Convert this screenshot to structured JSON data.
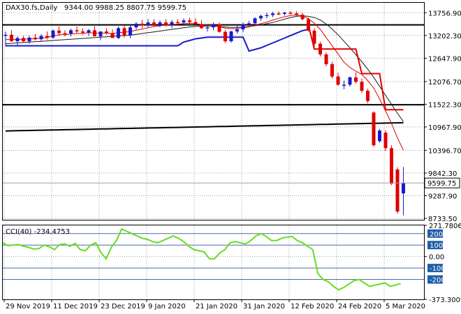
{
  "header": {
    "symbol": "DAX30.fs,Daily",
    "ohlc": "9344.00 9988.25 8807.75 9599.75"
  },
  "colors": {
    "bull": "#1a1acc",
    "bear": "#e00000",
    "ma_fast": "#e00000",
    "ma_slow": "#1a1a1a",
    "envelope_upper": "#e00000",
    "envelope_lower": "#1a1acc",
    "cci": "#66dd22",
    "level_line": "#000000",
    "level_box": "#1f5fa8"
  },
  "chart_data": [
    {
      "type": "candlestick",
      "title": "DAX30.fs,Daily",
      "ylim": [
        8700,
        14000
      ],
      "y_ticks": [
        13756.9,
        13202.3,
        12647.9,
        12076.7,
        11522.3,
        10967.9,
        10396.7,
        9842.3,
        9287.9,
        8733.5
      ],
      "x_tick_labels": [
        {
          "label": "29 Nov 2019",
          "index": 0
        },
        {
          "label": "11 Dec 2019",
          "index": 8
        },
        {
          "label": "23 Dec 2019",
          "index": 16
        },
        {
          "label": "9 Jan 2020",
          "index": 24
        },
        {
          "label": "21 Jan 2020",
          "index": 32
        },
        {
          "label": "31 Jan 2020",
          "index": 40
        },
        {
          "label": "12 Feb 2020",
          "index": 48
        },
        {
          "label": "24 Feb 2020",
          "index": 56
        },
        {
          "label": "5 Mar 2020",
          "index": 64
        }
      ],
      "current_price": 9599.75,
      "horizontal_levels": [
        13460,
        11510
      ],
      "candles": [
        {
          "o": 13210,
          "h": 13300,
          "l": 12940,
          "c": 13220
        },
        {
          "o": 13220,
          "h": 13340,
          "l": 13050,
          "c": 13060
        },
        {
          "o": 13060,
          "h": 13180,
          "l": 12950,
          "c": 13140
        },
        {
          "o": 13140,
          "h": 13190,
          "l": 13020,
          "c": 13060
        },
        {
          "o": 13060,
          "h": 13200,
          "l": 13000,
          "c": 13150
        },
        {
          "o": 13150,
          "h": 13240,
          "l": 13080,
          "c": 13110
        },
        {
          "o": 13110,
          "h": 13230,
          "l": 13060,
          "c": 13190
        },
        {
          "o": 13190,
          "h": 13300,
          "l": 13100,
          "c": 13150
        },
        {
          "o": 13150,
          "h": 13350,
          "l": 13120,
          "c": 13320
        },
        {
          "o": 13320,
          "h": 13420,
          "l": 13200,
          "c": 13260
        },
        {
          "o": 13260,
          "h": 13330,
          "l": 13180,
          "c": 13250
        },
        {
          "o": 13250,
          "h": 13370,
          "l": 13180,
          "c": 13330
        },
        {
          "o": 13330,
          "h": 13420,
          "l": 13250,
          "c": 13300
        },
        {
          "o": 13300,
          "h": 13380,
          "l": 13220,
          "c": 13270
        },
        {
          "o": 13270,
          "h": 13360,
          "l": 13190,
          "c": 13330
        },
        {
          "o": 13330,
          "h": 13430,
          "l": 13250,
          "c": 13180
        },
        {
          "o": 13180,
          "h": 13300,
          "l": 13090,
          "c": 13300
        },
        {
          "o": 13300,
          "h": 13380,
          "l": 13220,
          "c": 13260
        },
        {
          "o": 13260,
          "h": 13350,
          "l": 13180,
          "c": 13140
        },
        {
          "o": 13140,
          "h": 13420,
          "l": 13120,
          "c": 13380
        },
        {
          "o": 13380,
          "h": 13460,
          "l": 13150,
          "c": 13200
        },
        {
          "o": 13200,
          "h": 13470,
          "l": 13140,
          "c": 13400
        },
        {
          "o": 13400,
          "h": 13530,
          "l": 13350,
          "c": 13490
        },
        {
          "o": 13490,
          "h": 13580,
          "l": 13380,
          "c": 13450
        },
        {
          "o": 13450,
          "h": 13600,
          "l": 13400,
          "c": 13520
        },
        {
          "o": 13520,
          "h": 13600,
          "l": 13410,
          "c": 13460
        },
        {
          "o": 13460,
          "h": 13570,
          "l": 13400,
          "c": 13520
        },
        {
          "o": 13520,
          "h": 13600,
          "l": 13420,
          "c": 13470
        },
        {
          "o": 13470,
          "h": 13580,
          "l": 13380,
          "c": 13530
        },
        {
          "o": 13530,
          "h": 13600,
          "l": 13440,
          "c": 13520
        },
        {
          "o": 13520,
          "h": 13620,
          "l": 13460,
          "c": 13570
        },
        {
          "o": 13570,
          "h": 13640,
          "l": 13480,
          "c": 13530
        },
        {
          "o": 13530,
          "h": 13620,
          "l": 13450,
          "c": 13480
        },
        {
          "o": 13480,
          "h": 13580,
          "l": 13360,
          "c": 13380
        },
        {
          "o": 13380,
          "h": 13460,
          "l": 13300,
          "c": 13400
        },
        {
          "o": 13400,
          "h": 13520,
          "l": 13330,
          "c": 13480
        },
        {
          "o": 13480,
          "h": 13520,
          "l": 13270,
          "c": 13290
        },
        {
          "o": 13290,
          "h": 13330,
          "l": 13020,
          "c": 13060
        },
        {
          "o": 13060,
          "h": 13320,
          "l": 13030,
          "c": 13300
        },
        {
          "o": 13300,
          "h": 13460,
          "l": 13250,
          "c": 13350
        },
        {
          "o": 13350,
          "h": 13520,
          "l": 13280,
          "c": 13480
        },
        {
          "o": 13480,
          "h": 13560,
          "l": 13420,
          "c": 13500
        },
        {
          "o": 13500,
          "h": 13650,
          "l": 13480,
          "c": 13620
        },
        {
          "o": 13620,
          "h": 13710,
          "l": 13560,
          "c": 13680
        },
        {
          "o": 13680,
          "h": 13760,
          "l": 13620,
          "c": 13700
        },
        {
          "o": 13700,
          "h": 13780,
          "l": 13650,
          "c": 13740
        },
        {
          "o": 13740,
          "h": 13790,
          "l": 13700,
          "c": 13730
        },
        {
          "o": 13730,
          "h": 13780,
          "l": 13690,
          "c": 13760
        },
        {
          "o": 13760,
          "h": 13800,
          "l": 13710,
          "c": 13740
        },
        {
          "o": 13740,
          "h": 13790,
          "l": 13680,
          "c": 13710
        },
        {
          "o": 13710,
          "h": 13760,
          "l": 13570,
          "c": 13600
        },
        {
          "o": 13600,
          "h": 13640,
          "l": 13300,
          "c": 13320
        },
        {
          "o": 13320,
          "h": 13380,
          "l": 12900,
          "c": 13000
        },
        {
          "o": 13000,
          "h": 13050,
          "l": 12690,
          "c": 12740
        },
        {
          "o": 12740,
          "h": 12790,
          "l": 12450,
          "c": 12500
        },
        {
          "o": 12500,
          "h": 12560,
          "l": 12150,
          "c": 12200
        },
        {
          "o": 12200,
          "h": 12290,
          "l": 11970,
          "c": 12000
        },
        {
          "o": 12000,
          "h": 12100,
          "l": 11890,
          "c": 12000
        },
        {
          "o": 12000,
          "h": 12200,
          "l": 11950,
          "c": 12180
        },
        {
          "o": 12180,
          "h": 12300,
          "l": 12030,
          "c": 12070
        },
        {
          "o": 12070,
          "h": 12150,
          "l": 11800,
          "c": 11850
        },
        {
          "o": 11850,
          "h": 11900,
          "l": 11550,
          "c": 11600
        },
        {
          "o": 11320,
          "h": 11350,
          "l": 10480,
          "c": 10520
        },
        {
          "o": 10620,
          "h": 10920,
          "l": 10580,
          "c": 10880
        },
        {
          "o": 10830,
          "h": 10890,
          "l": 10380,
          "c": 10450
        },
        {
          "o": 10450,
          "h": 10520,
          "l": 9550,
          "c": 9580
        },
        {
          "o": 9930,
          "h": 9980,
          "l": 8850,
          "c": 8900
        },
        {
          "o": 9344.0,
          "h": 9988.25,
          "l": 8807.75,
          "c": 9599.75
        }
      ],
      "ma_fast": [
        13100,
        13110,
        13100,
        13110,
        13120,
        13120,
        13140,
        13150,
        13190,
        13220,
        13220,
        13240,
        13250,
        13250,
        13270,
        13260,
        13260,
        13260,
        13250,
        13270,
        13280,
        13300,
        13330,
        13360,
        13390,
        13420,
        13440,
        13460,
        13470,
        13480,
        13490,
        13500,
        13490,
        13470,
        13460,
        13450,
        13420,
        13380,
        13370,
        13370,
        13390,
        13410,
        13450,
        13490,
        13530,
        13580,
        13620,
        13660,
        13690,
        13700,
        13680,
        13610,
        13500,
        13350,
        13150,
        12950,
        12750,
        12550,
        12420,
        12330,
        12250,
        12100,
        11920,
        11650,
        11360,
        11050,
        10700,
        10400
      ],
      "ma_slow": [
        13000,
        13010,
        13020,
        13030,
        13040,
        13050,
        13060,
        13070,
        13080,
        13090,
        13100,
        13110,
        13120,
        13130,
        13140,
        13150,
        13160,
        13170,
        13180,
        13190,
        13200,
        13210,
        13230,
        13250,
        13270,
        13290,
        13310,
        13330,
        13350,
        13370,
        13390,
        13410,
        13420,
        13430,
        13430,
        13430,
        13420,
        13410,
        13400,
        13400,
        13410,
        13420,
        13440,
        13460,
        13490,
        13520,
        13560,
        13600,
        13640,
        13670,
        13680,
        13670,
        13640,
        13580,
        13480,
        13360,
        13220,
        13060,
        12900,
        12730,
        12560,
        12380,
        12180,
        11960,
        11740,
        11520,
        11300,
        11100
      ],
      "ma_long": [
        10870,
        10873,
        10876,
        10879,
        10882,
        10885,
        10888,
        10891,
        10894,
        10897,
        10900,
        10903,
        10906,
        10909,
        10912,
        10915,
        10918,
        10921,
        10924,
        10927,
        10930,
        10933,
        10936,
        10939,
        10942,
        10945,
        10948,
        10951,
        10954,
        10957,
        10960,
        10963,
        10966,
        10969,
        10972,
        10975,
        10978,
        10981,
        10984,
        10987,
        10990,
        10993,
        10996,
        10999,
        11002,
        11005,
        11008,
        11011,
        11014,
        11017,
        11020,
        11023,
        11026,
        11029,
        11032,
        11035,
        11038,
        11041,
        11044,
        11047,
        11050,
        11053,
        11056,
        11059,
        11062,
        11065,
        11068,
        11071
      ],
      "envelope_upper": {
        "x": [
          47,
          52,
          53,
          57,
          58,
          62,
          63,
          65,
          68
        ],
        "y": [
          13460,
          13460,
          13460,
          13460,
          13460,
          13460,
          13460,
          13460,
          13460
        ]
      },
      "step_upper": {
        "x": [
          51,
          52,
          59,
          60,
          63,
          64,
          67
        ],
        "y": [
          13460,
          12870,
          12870,
          12270,
          12270,
          11390,
          11390
        ]
      },
      "envelope_lower": {
        "x": [
          0,
          1,
          2,
          3,
          4,
          5,
          6,
          7,
          8,
          9,
          10,
          11,
          12,
          13,
          14,
          15,
          16,
          17,
          18,
          19,
          20,
          21,
          22,
          23,
          24,
          25,
          26,
          27,
          28,
          29,
          30,
          31,
          32,
          33,
          34,
          35,
          36,
          37,
          38,
          39,
          40,
          41,
          42,
          43,
          44,
          45,
          46,
          47,
          48,
          49,
          50,
          51
        ],
        "y": [
          12950,
          12950,
          12950,
          12950,
          12950,
          12950,
          12950,
          12950,
          12950,
          12950,
          12950,
          12950,
          12950,
          12950,
          12950,
          12950,
          12950,
          12950,
          12950,
          12950,
          12950,
          12950,
          12950,
          12950,
          12950,
          12950,
          12950,
          12950,
          12950,
          12950,
          13040,
          13080,
          13120,
          13140,
          13160,
          13160,
          13160,
          13160,
          13160,
          13160,
          13160,
          12820,
          12860,
          12900,
          12960,
          13020,
          13080,
          13140,
          13200,
          13260,
          13320,
          13350
        ]
      }
    },
    {
      "type": "line",
      "title": "CCI(40) -234.4753",
      "series": [
        {
          "name": "CCI(40)",
          "values": [
            120,
            95,
            100,
            105,
            90,
            80,
            65,
            70,
            100,
            85,
            60,
            105,
            110,
            90,
            115,
            60,
            50,
            100,
            120,
            35,
            -20,
            80,
            140,
            240,
            220,
            200,
            180,
            160,
            150,
            130,
            120,
            140,
            160,
            180,
            160,
            130,
            90,
            60,
            50,
            40,
            -20,
            -20,
            30,
            60,
            120,
            130,
            120,
            110,
            140,
            180,
            200,
            175,
            140,
            140,
            160,
            170,
            175,
            140,
            120,
            90,
            60,
            -150,
            -200,
            -220,
            -260,
            -290,
            -270,
            -240,
            -210,
            -200,
            -230,
            -260,
            -250,
            -240,
            -230,
            -260,
            -250,
            -234.4753
          ]
        }
      ],
      "ylim": [
        -373.3009,
        271.7806
      ],
      "y_ticks": [
        271.7806,
        200,
        100,
        0.0,
        -100,
        -200,
        -373.3009
      ],
      "levels": [
        100,
        -100,
        200,
        -200
      ]
    }
  ]
}
